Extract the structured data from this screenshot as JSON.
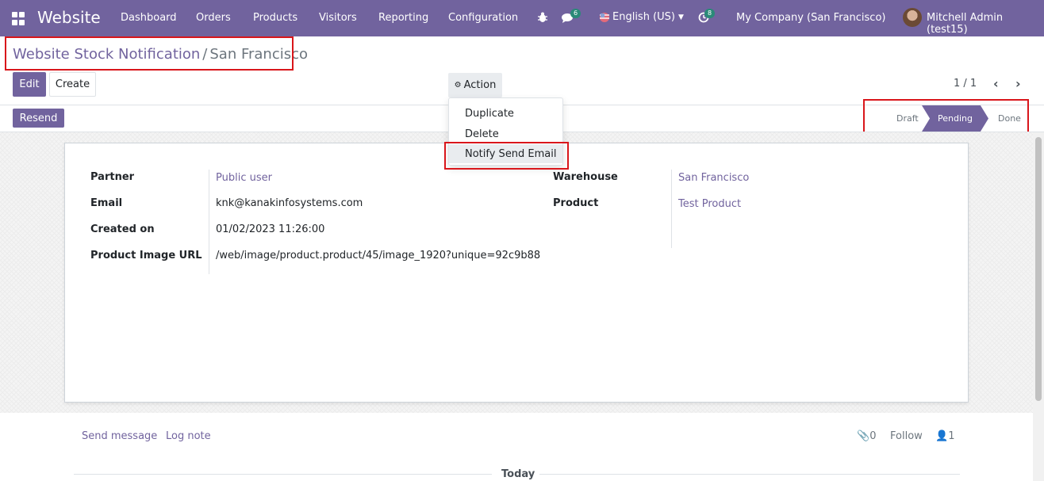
{
  "navbar": {
    "brand": "Website",
    "menus": [
      "Dashboard",
      "Orders",
      "Products",
      "Visitors",
      "Reporting",
      "Configuration"
    ],
    "messages_badge": "6",
    "language": "English (US)",
    "activities_badge": "8",
    "company": "My Company (San Francisco)",
    "user": "Mitchell Admin (test15)"
  },
  "breadcrumb": {
    "parent": "Website Stock Notification",
    "separator": "/",
    "current": "San Francisco"
  },
  "buttons": {
    "edit": "Edit",
    "create": "Create",
    "action": "Action",
    "resend": "Resend"
  },
  "pager": "1 / 1",
  "action_menu": {
    "items": [
      "Duplicate",
      "Delete",
      "Notify Send Email"
    ]
  },
  "status": {
    "stages": [
      "Draft",
      "Pending",
      "Done"
    ],
    "active": "Pending"
  },
  "form": {
    "left": [
      {
        "label": "Partner",
        "value": "Public user"
      },
      {
        "label": "Email",
        "value": "knk@kanakinfosystems.com"
      },
      {
        "label": "Created on",
        "value": "01/02/2023 11:26:00"
      },
      {
        "label": "Product Image URL",
        "value": "/web/image/product.product/45/image_1920?unique=92c9b88"
      }
    ],
    "right": [
      {
        "label": "Warehouse",
        "value": "San Francisco"
      },
      {
        "label": "Product",
        "value": "Test Product"
      }
    ]
  },
  "chatter": {
    "send_message": "Send message",
    "log_note": "Log note",
    "attachments": "0",
    "follow": "Follow",
    "followers": "1",
    "today": "Today"
  },
  "colors": {
    "brand": "#71639e",
    "highlight": "#d9161b"
  }
}
